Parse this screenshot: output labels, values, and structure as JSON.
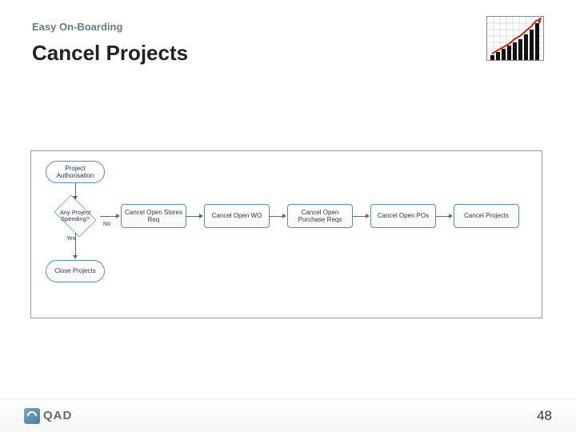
{
  "header": {
    "breadcrumb": "Easy On-Boarding",
    "title": "Cancel Projects"
  },
  "flow": {
    "start": "Project Authorisation",
    "decision": "Any Project Spending?",
    "decision_no": "No",
    "decision_yes": "Yes",
    "steps": [
      "Cancel Open Stores Req",
      "Cancel Open WO",
      "Cancel Open Purchase Reqs",
      "Cancel Open POs",
      "Cancel Projects"
    ],
    "close": "Close Projects"
  },
  "footer": {
    "brand": "QAD",
    "page": "48"
  },
  "chart_data": {
    "type": "bar",
    "note": "decorative growth-bar icon in slide corner; values are approximate relative heights",
    "categories": [
      "1",
      "2",
      "3",
      "4",
      "5",
      "6",
      "7",
      "8",
      "9"
    ],
    "series": [
      {
        "name": "bars-black",
        "values": [
          6,
          10,
          14,
          18,
          22,
          26,
          32,
          38,
          46
        ]
      },
      {
        "name": "trend-red",
        "values": [
          8,
          12,
          16,
          20,
          26,
          30,
          36,
          42,
          50
        ]
      }
    ],
    "ylim": [
      0,
      55
    ]
  }
}
